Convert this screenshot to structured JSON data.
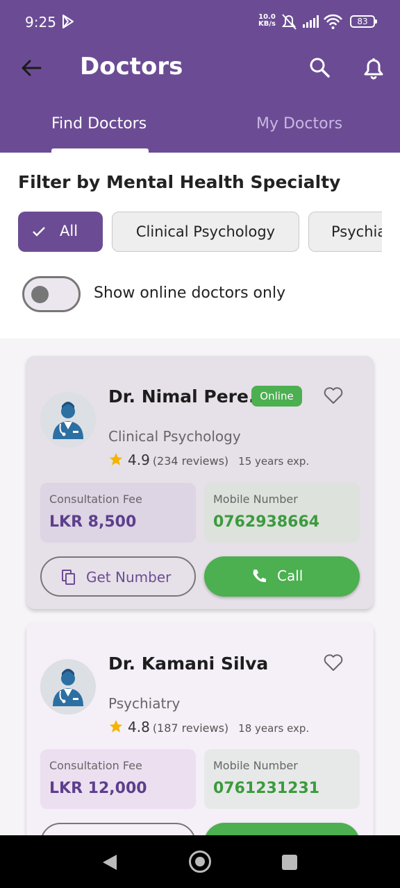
{
  "status_bar": {
    "time": "9:25",
    "net_speed_top": "10.0",
    "net_speed_bottom": "KB/s",
    "battery": "83"
  },
  "app_bar": {
    "title": "Doctors"
  },
  "tabs": [
    {
      "label": "Find Doctors",
      "active": true
    },
    {
      "label": "My Doctors",
      "active": false
    }
  ],
  "filter": {
    "title": "Filter by Mental Health Specialty",
    "chips": [
      {
        "label": "All",
        "selected": true
      },
      {
        "label": "Clinical Psychology",
        "selected": false
      },
      {
        "label": "Psychiatry",
        "selected": false
      }
    ],
    "online_toggle": {
      "label": "Show online doctors only",
      "on": false
    }
  },
  "doctors": [
    {
      "name": "Dr. Nimal Pere...",
      "online_badge": "Online",
      "specialty": "Clinical Psychology",
      "rating": "4.9",
      "reviews": "(234 reviews)",
      "experience": "15 years exp.",
      "fee_label": "Consultation Fee",
      "fee": "LKR 8,500",
      "mobile_label": "Mobile Number",
      "mobile": "0762938664",
      "get_number_label": "Get Number",
      "call_label": "Call"
    },
    {
      "name": "Dr. Kamani Silva",
      "specialty": "Psychiatry",
      "rating": "4.8",
      "reviews": "(187 reviews)",
      "experience": "18 years exp.",
      "fee_label": "Consultation Fee",
      "fee": "LKR 12,000",
      "mobile_label": "Mobile Number",
      "mobile": "0761231231"
    }
  ],
  "colors": {
    "primary": "#6b4c94",
    "online_green": "#4caf50",
    "star": "#f4b400"
  }
}
